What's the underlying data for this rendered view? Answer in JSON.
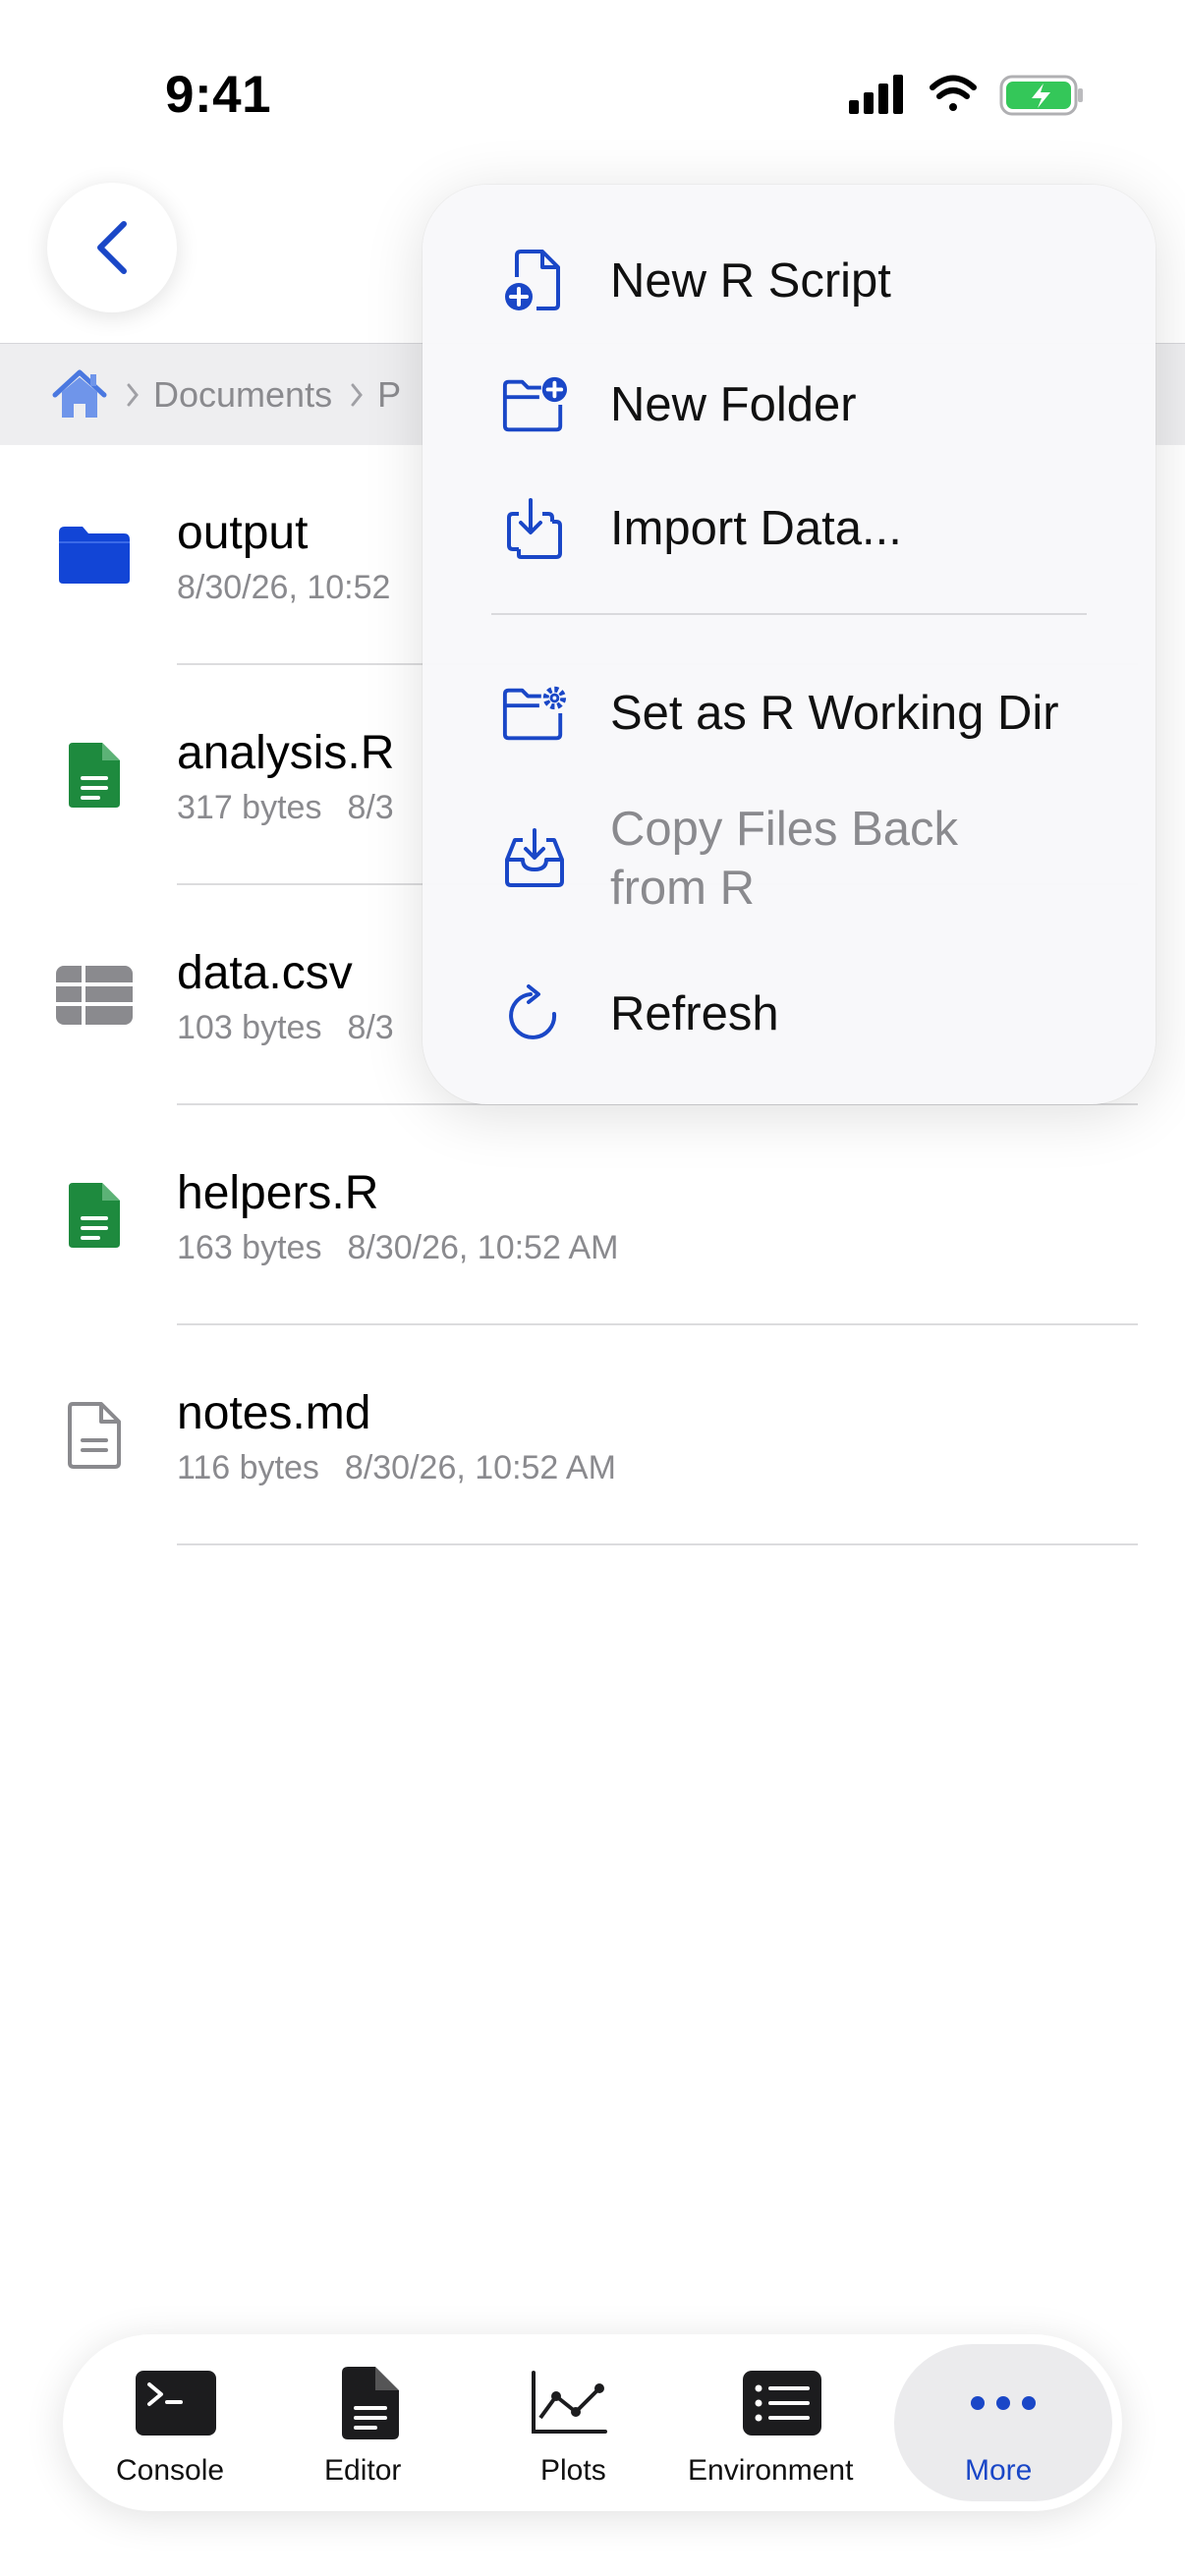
{
  "status_bar": {
    "time": "9:41"
  },
  "breadcrumb": {
    "items": [
      "Documents",
      "P"
    ]
  },
  "files": [
    {
      "name": "output",
      "size": "",
      "date": "8/30/26, 10:52",
      "icon": "folder-icon"
    },
    {
      "name": "analysis.R",
      "size": "317 bytes",
      "date": "8/3",
      "icon": "r-file-icon"
    },
    {
      "name": "data.csv",
      "size": "103 bytes",
      "date": "8/3",
      "icon": "table-icon"
    },
    {
      "name": "helpers.R",
      "size": "163 bytes",
      "date": "8/30/26, 10:52 AM",
      "icon": "r-file-icon"
    },
    {
      "name": "notes.md",
      "size": "116 bytes",
      "date": "8/30/26, 10:52 AM",
      "icon": "doc-icon"
    }
  ],
  "menu": {
    "items": [
      {
        "label": "New R Script",
        "icon": "new-script-icon",
        "enabled": true
      },
      {
        "label": "New Folder",
        "icon": "new-folder-icon",
        "enabled": true
      },
      {
        "label": "Import Data...",
        "icon": "import-icon",
        "enabled": true
      },
      {
        "label": "Set as R Working Dir",
        "icon": "folder-gear-icon",
        "enabled": true
      },
      {
        "label": "Copy Files Back from R",
        "icon": "tray-download-icon",
        "enabled": false
      },
      {
        "label": "Refresh",
        "icon": "refresh-icon",
        "enabled": true
      }
    ]
  },
  "tabbar": {
    "tabs": [
      {
        "label": "Console",
        "icon": "terminal-icon"
      },
      {
        "label": "Editor",
        "icon": "document-icon"
      },
      {
        "label": "Plots",
        "icon": "chart-icon"
      },
      {
        "label": "Environment",
        "icon": "list-icon"
      },
      {
        "label": "More",
        "icon": "ellipsis-icon",
        "active": true
      }
    ]
  },
  "colors": {
    "accent": "#1a47c7",
    "folder": "#1245d6",
    "r_file": "#1e8a3e",
    "battery": "#34c759",
    "secondary_text": "#8a8a8e"
  }
}
